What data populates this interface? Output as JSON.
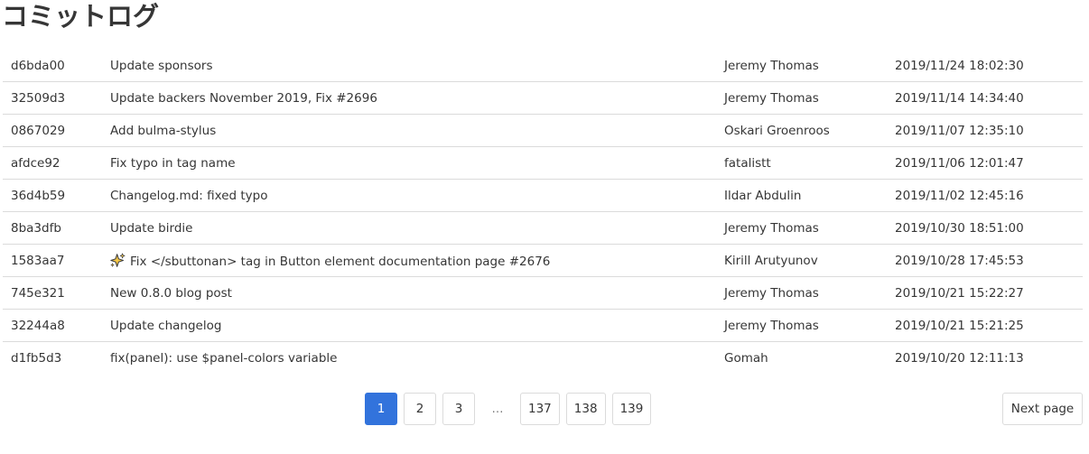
{
  "page": {
    "title": "コミットログ"
  },
  "commits": [
    {
      "hash": "d6bda00",
      "message": "Update sponsors",
      "author": "Jeremy Thomas",
      "date": "2019/11/24 18:02:30"
    },
    {
      "hash": "32509d3",
      "message": "Update backers November 2019, Fix #2696",
      "author": "Jeremy Thomas",
      "date": "2019/11/14 14:34:40"
    },
    {
      "hash": "0867029",
      "message": "Add bulma-stylus",
      "author": "Oskari Groenroos",
      "date": "2019/11/07 12:35:10"
    },
    {
      "hash": "afdce92",
      "message": "Fix typo in tag name",
      "author": "fatalistt",
      "date": "2019/11/06 12:01:47"
    },
    {
      "hash": "36d4b59",
      "message": "Changelog.md: fixed typo",
      "author": "Ildar Abdulin",
      "date": "2019/11/02 12:45:16"
    },
    {
      "hash": "8ba3dfb",
      "message": "Update birdie",
      "author": "Jeremy Thomas",
      "date": "2019/10/30 18:51:00"
    },
    {
      "hash": "1583aa7",
      "message": "Fix </sbuttonan> tag in Button element documentation page #2676",
      "author": "Kirill Arutyunov",
      "date": "2019/10/28 17:45:53",
      "icon": "sparkles-icon"
    },
    {
      "hash": "745e321",
      "message": "New 0.8.0 blog post",
      "author": "Jeremy Thomas",
      "date": "2019/10/21 15:22:27"
    },
    {
      "hash": "32244a8",
      "message": "Update changelog",
      "author": "Jeremy Thomas",
      "date": "2019/10/21 15:21:25"
    },
    {
      "hash": "d1fb5d3",
      "message": "fix(panel): use $panel-colors variable",
      "author": "Gomah",
      "date": "2019/10/20 12:11:13"
    }
  ],
  "pagination": {
    "pages": [
      "1",
      "2",
      "3",
      "137",
      "138",
      "139"
    ],
    "current": "1",
    "ellipsis": "…",
    "next_label": "Next page"
  },
  "colors": {
    "accent": "#3273dc",
    "text": "#363636",
    "border": "#dbdbdb"
  }
}
